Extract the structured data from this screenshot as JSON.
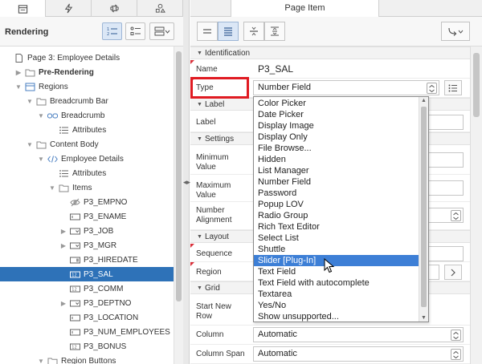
{
  "left": {
    "title": "Rendering",
    "tabs": [
      "rendering-tab-icon",
      "dynamic-actions-icon",
      "processing-icon",
      "shared-components-icon"
    ],
    "tree": [
      {
        "label": "Page 3: Employee Details",
        "icon": "page-icon",
        "indent": 0,
        "twisty": "none",
        "bold": false
      },
      {
        "label": "Pre-Rendering",
        "icon": "folder-icon",
        "indent": 1,
        "twisty": "collapsed",
        "bold": true
      },
      {
        "label": "Regions",
        "icon": "regions-icon",
        "indent": 1,
        "twisty": "expanded",
        "bold": false
      },
      {
        "label": "Breadcrumb Bar",
        "icon": "folder-icon",
        "indent": 2,
        "twisty": "expanded",
        "bold": false
      },
      {
        "label": "Breadcrumb",
        "icon": "breadcrumb-icon",
        "indent": 3,
        "twisty": "expanded",
        "bold": false
      },
      {
        "label": "Attributes",
        "icon": "attributes-icon",
        "indent": 4,
        "twisty": "none",
        "bold": false
      },
      {
        "label": "Content Body",
        "icon": "folder-icon",
        "indent": 2,
        "twisty": "expanded",
        "bold": false
      },
      {
        "label": "Employee Details",
        "icon": "code-icon",
        "indent": 3,
        "twisty": "expanded",
        "bold": false
      },
      {
        "label": "Attributes",
        "icon": "attributes-icon",
        "indent": 4,
        "twisty": "none",
        "bold": false
      },
      {
        "label": "Items",
        "icon": "folder-icon",
        "indent": 4,
        "twisty": "expanded",
        "bold": false
      },
      {
        "label": "P3_EMPNO",
        "icon": "hidden-item-icon",
        "indent": 5,
        "twisty": "none",
        "bold": false
      },
      {
        "label": "P3_ENAME",
        "icon": "text-item-icon",
        "indent": 5,
        "twisty": "none",
        "bold": false
      },
      {
        "label": "P3_JOB",
        "icon": "select-item-icon",
        "indent": 5,
        "twisty": "collapsed",
        "bold": false
      },
      {
        "label": "P3_MGR",
        "icon": "select-item-icon",
        "indent": 5,
        "twisty": "collapsed",
        "bold": false
      },
      {
        "label": "P3_HIREDATE",
        "icon": "date-item-icon",
        "indent": 5,
        "twisty": "none",
        "bold": false
      },
      {
        "label": "P3_SAL",
        "icon": "number-item-icon",
        "indent": 5,
        "twisty": "none",
        "bold": false,
        "selected": true
      },
      {
        "label": "P3_COMM",
        "icon": "number-item-icon",
        "indent": 5,
        "twisty": "none",
        "bold": false
      },
      {
        "label": "P3_DEPTNO",
        "icon": "select-item-icon",
        "indent": 5,
        "twisty": "collapsed",
        "bold": false
      },
      {
        "label": "P3_LOCATION",
        "icon": "text-item-icon",
        "indent": 5,
        "twisty": "none",
        "bold": false
      },
      {
        "label": "P3_NUM_EMPLOYEES",
        "icon": "text-item-icon",
        "indent": 5,
        "twisty": "none",
        "bold": false
      },
      {
        "label": "P3_BONUS",
        "icon": "number-item-icon",
        "indent": 5,
        "twisty": "none",
        "bold": false
      },
      {
        "label": "Region Buttons",
        "icon": "folder-icon",
        "indent": 3,
        "twisty": "expanded",
        "bold": false
      }
    ]
  },
  "right": {
    "tab": "Page Item",
    "sections": {
      "identification": "Identification",
      "label": "Label",
      "settings": "Settings",
      "layout": "Layout",
      "grid": "Grid"
    },
    "fields": {
      "name_label": "Name",
      "name_value": "P3_SAL",
      "type_label": "Type",
      "type_value": "Number Field",
      "label_label": "Label",
      "min_label": "Minimum Value",
      "max_label": "Maximum Value",
      "num_align_label": "Number Alignment",
      "sequence_label": "Sequence",
      "region_label": "Region",
      "start_new_row_label": "Start New Row",
      "column_label": "Column",
      "column_value": "Automatic",
      "column_span_label": "Column Span",
      "column_span_value": "Automatic"
    },
    "dropdown_options": [
      "Color Picker",
      "Date Picker",
      "Display Image",
      "Display Only",
      "File Browse...",
      "Hidden",
      "List Manager",
      "Number Field",
      "Password",
      "Popup LOV",
      "Radio Group",
      "Rich Text Editor",
      "Select List",
      "Shuttle",
      "Slider [Plug-In]",
      "Text Field",
      "Text Field with autocomplete",
      "Textarea",
      "Yes/No",
      "Show unsupported..."
    ],
    "highlighted_option": "Slider [Plug-In]"
  },
  "colors": {
    "selection": "#2e72b8",
    "highlight": "#3d7fd6",
    "required_mark": "#d9303a",
    "callout": "#e01b22"
  }
}
